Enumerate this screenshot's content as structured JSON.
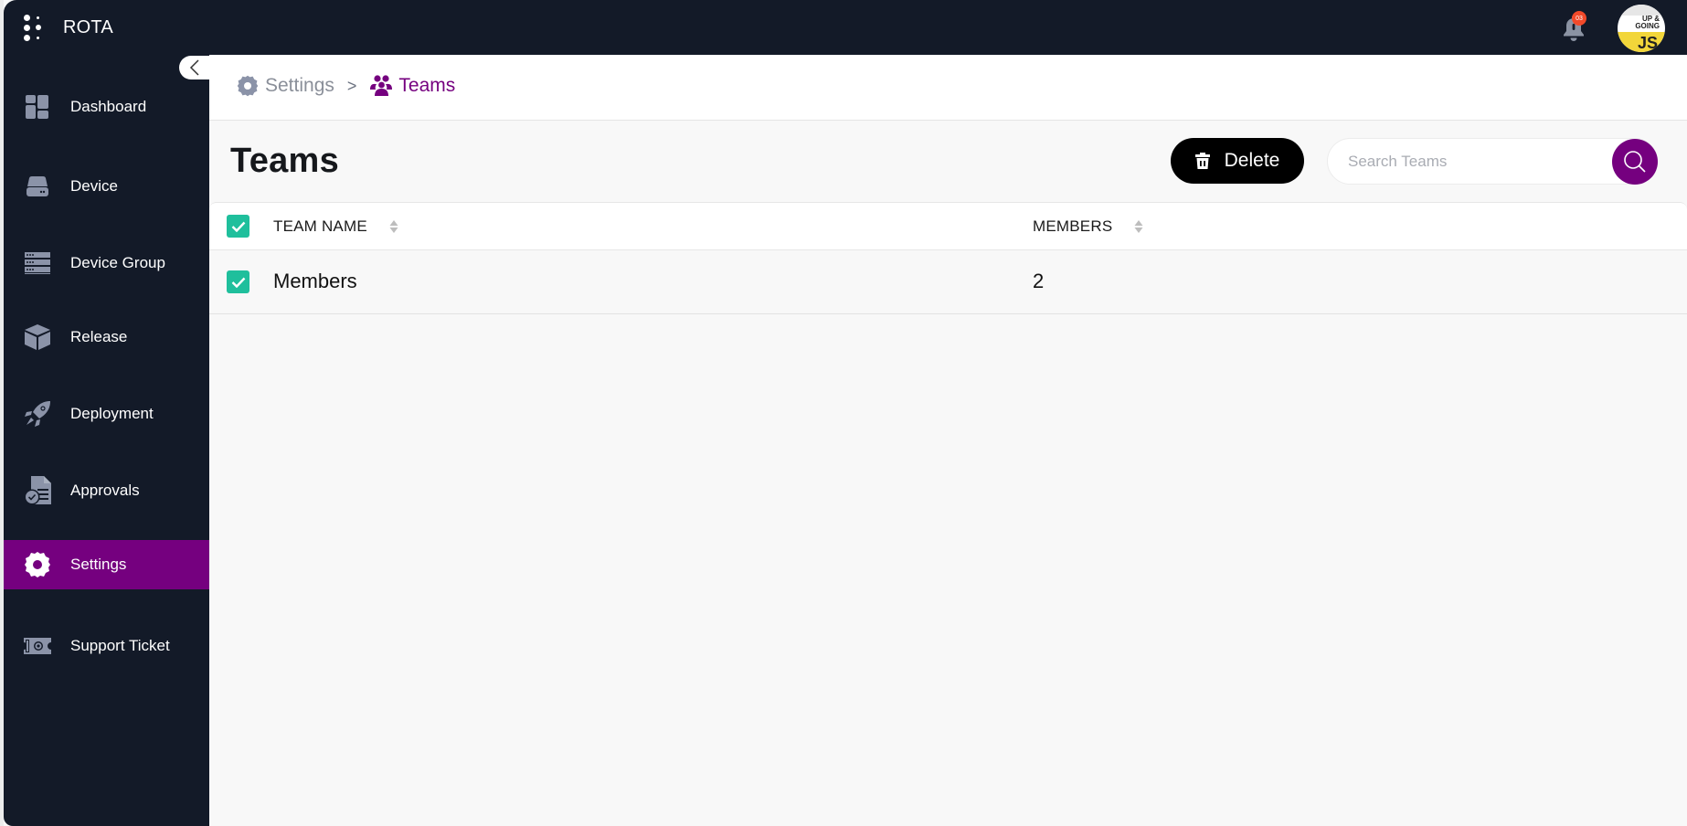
{
  "app": {
    "brand_name": "ROTA",
    "notification_count": "03"
  },
  "sidebar": {
    "items": [
      {
        "label": "Dashboard",
        "icon": "dashboard-icon",
        "active": false
      },
      {
        "label": "Device",
        "icon": "device-icon",
        "active": false
      },
      {
        "label": "Device Group",
        "icon": "device-group-icon",
        "active": false
      },
      {
        "label": "Release",
        "icon": "release-box-icon",
        "active": false
      },
      {
        "label": "Deployment",
        "icon": "rocket-icon",
        "active": false
      },
      {
        "label": "Approvals",
        "icon": "approvals-icon",
        "active": false
      },
      {
        "label": "Settings",
        "icon": "gear-icon",
        "active": true
      },
      {
        "label": "Support Ticket",
        "icon": "ticket-icon",
        "active": false
      }
    ]
  },
  "breadcrumb": {
    "items": [
      {
        "label": "Settings",
        "icon": "gear-icon"
      },
      {
        "label": "Teams",
        "icon": "users-icon"
      }
    ],
    "separator": ">"
  },
  "page": {
    "title": "Teams",
    "delete_label": "Delete",
    "search_placeholder": "Search Teams",
    "search_value": ""
  },
  "table": {
    "columns": [
      "TEAM NAME",
      "MEMBERS"
    ],
    "rows": [
      {
        "team_name": "Members",
        "members": "2",
        "checked": true
      }
    ],
    "select_all_checked": true
  },
  "avatar": {
    "line1": "UP &",
    "line2": "GOING",
    "line3": "JS"
  },
  "colors": {
    "accent": "#75007f",
    "sidebar_bg": "#131a28",
    "checkbox": "#1fbf9c",
    "badge": "#f24a2a"
  }
}
